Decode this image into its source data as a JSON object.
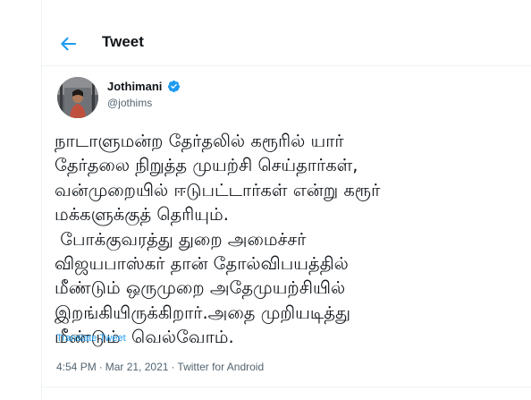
{
  "header": {
    "title": "Tweet",
    "back_icon": "arrow-left-icon",
    "accent_color": "#1d9bf0"
  },
  "tweet": {
    "author_name": "Jothimani",
    "author_handle": "@jothims",
    "verified": true,
    "text_lines": [
      "நாடாளுமன்ற தேர்தலில் கரூரில் யார்",
      "தேர்தலை நிறுத்த முயற்சி செய்தார்கள்,",
      "வன்முறையில் ஈடுபட்டார்கள் என்று கரூர்",
      "மக்களுக்குத் தெரியும்.",
      " போக்குவரத்து துறை அமைச்சர்",
      "விஜயபாஸ்கர் தான் தோல்விபயத்தில்",
      "மீண்டும் ஒருமுறை அதேமுயற்சியில்",
      "இறங்கியிருக்கிறார்.அதை முறியடித்து",
      "மீண்டும்  வெல்வோம்."
    ],
    "translate_label": "Translate Tweet",
    "time": "4:54 PM",
    "date": "Mar 21, 2021",
    "source": "Twitter for Android",
    "separator": "·"
  }
}
